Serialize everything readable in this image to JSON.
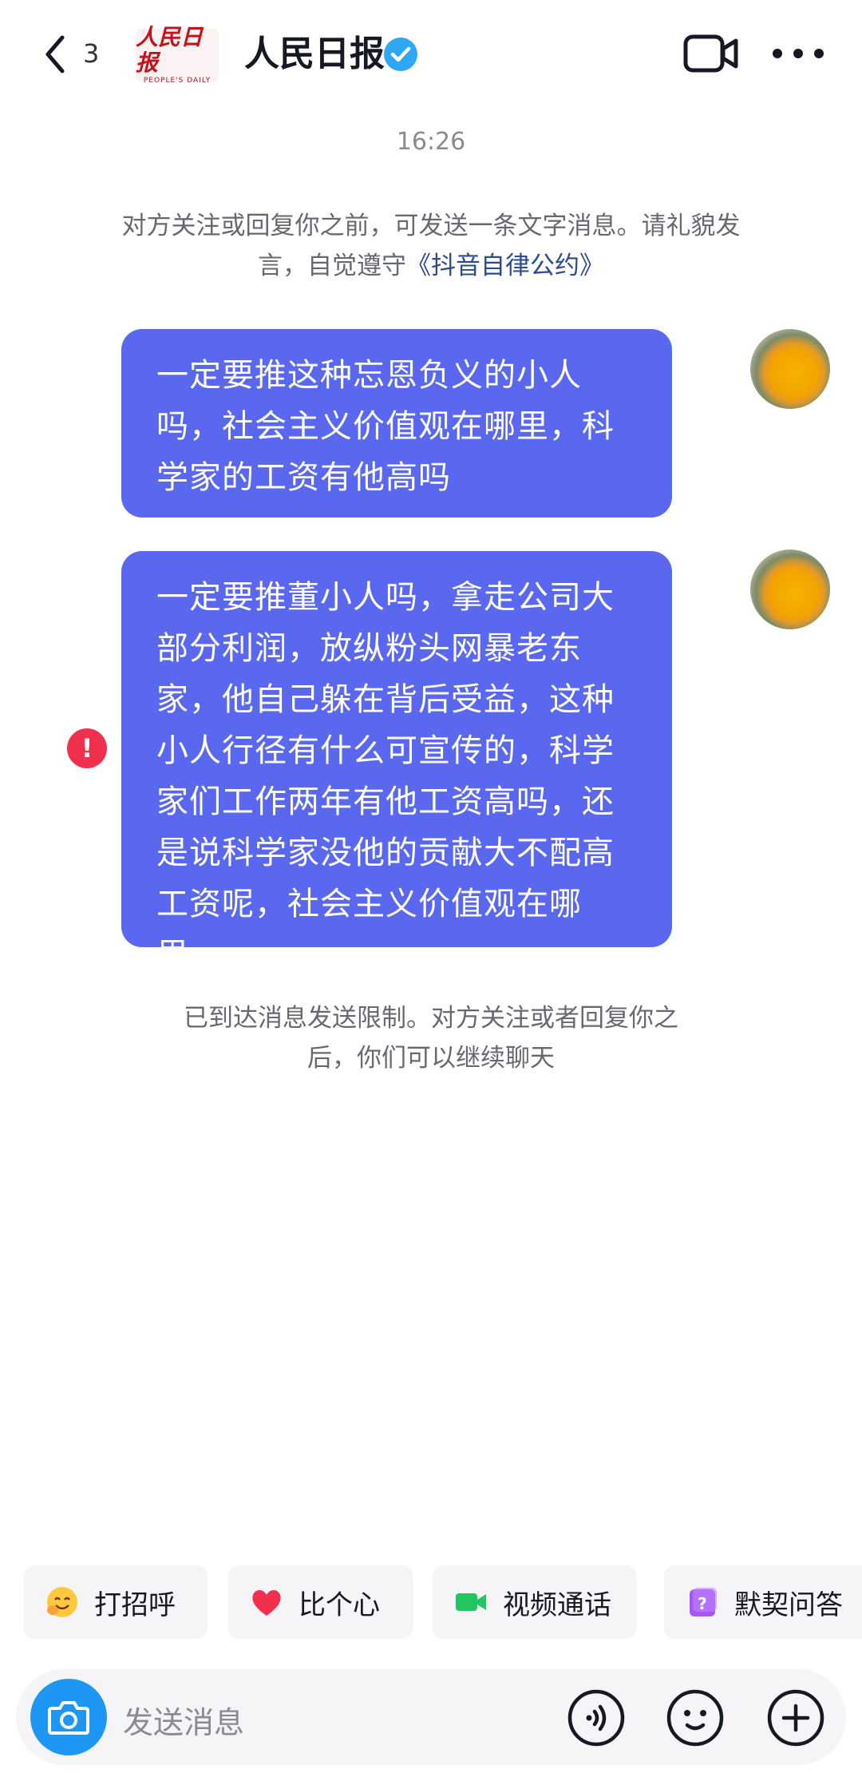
{
  "header": {
    "unread_count": "3",
    "logo_cn": "人民日报",
    "logo_en": "PEOPLE'S DAILY",
    "title": "人民日报"
  },
  "chat": {
    "timestamp": "16:26",
    "notice_prefix": "对方关注或回复你之前，可发送一条文字消息。请礼貌发言，自觉遵守",
    "notice_link": "《抖音自律公约》",
    "messages": [
      {
        "text": "一定要推这种忘恩负义的小人吗，社会主义价值观在哪里，科学家的工资有他高吗",
        "failed": false
      },
      {
        "text": "一定要推董小人吗，拿走公司大部分利润，放纵粉头网暴老东家，他自己躲在背后受益，这种小人行径有什么可宣传的，科学家们工作两年有他工资高吗，还是说科学家没他的贡献大不配高工资呢，社会主义价值观在哪里，",
        "failed": true
      }
    ],
    "failed_icon": "!",
    "limit_notice": "已到达消息发送限制。对方关注或者回复你之后，你们可以继续聊天"
  },
  "quick_actions": [
    {
      "label": "打招呼",
      "icon": "wave-emoji-icon"
    },
    {
      "label": "比个心",
      "icon": "heart-icon"
    },
    {
      "label": "视频通话",
      "icon": "video-call-icon"
    },
    {
      "label": "默契问答",
      "icon": "question-card-icon"
    }
  ],
  "input": {
    "placeholder": "发送消息"
  },
  "colors": {
    "bubble": "#5a68f0",
    "link": "#2b4a8f",
    "error": "#f0304d",
    "camera": "#1e97f4",
    "verified": "#2fa7f3"
  }
}
